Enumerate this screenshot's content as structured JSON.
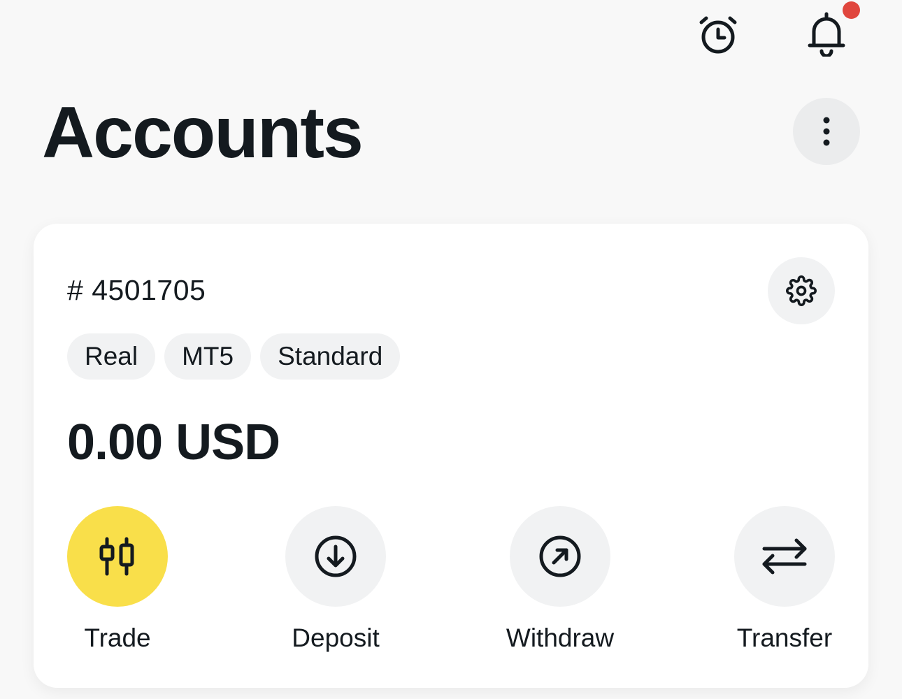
{
  "header": {
    "title": "Accounts",
    "icons": {
      "alarm": "alarm-clock-icon",
      "notifications": "bell-icon",
      "more": "more-vertical-icon"
    },
    "has_unread_notification": true
  },
  "account_card": {
    "account_number": "# 4501705",
    "tags": [
      "Real",
      "MT5",
      "Standard"
    ],
    "balance": "0.00 USD",
    "settings_icon": "gear-icon",
    "actions": [
      {
        "label": "Trade",
        "icon": "candlestick-icon",
        "primary": true
      },
      {
        "label": "Deposit",
        "icon": "arrow-down-circle-icon",
        "primary": false
      },
      {
        "label": "Withdraw",
        "icon": "arrow-up-right-circle-icon",
        "primary": false
      },
      {
        "label": "Transfer",
        "icon": "swap-arrows-icon",
        "primary": false
      }
    ]
  },
  "colors": {
    "background": "#f8f8f8",
    "card": "#ffffff",
    "text": "#141a1f",
    "accent_yellow": "#f9df4a",
    "notification_dot": "#e0463d",
    "chip_background": "#f1f2f3"
  }
}
